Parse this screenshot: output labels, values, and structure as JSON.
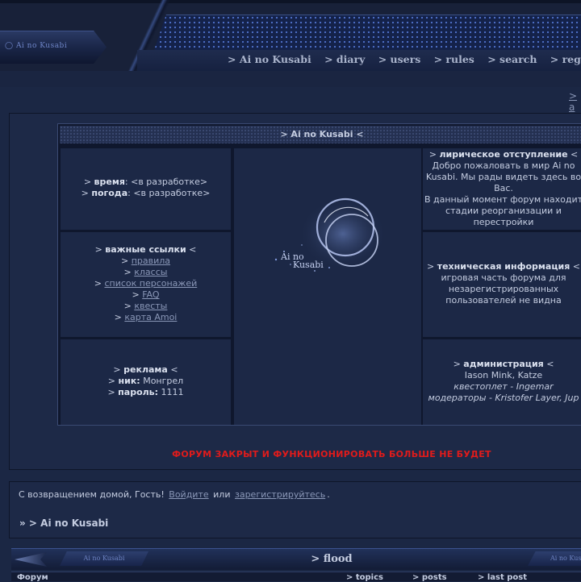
{
  "header": {
    "logo_small": "Ai no Kusabi",
    "nav": [
      "> Ai no Kusabi",
      "> diary",
      "> users",
      "> rules",
      "> search",
      "> registration",
      ">"
    ]
  },
  "corner_link": "> a",
  "table": {
    "title": "> Ai no Kusabi <",
    "left1": {
      "line1_prefix": ">",
      "line1_key": "время",
      "line1_val": ": <в разработке>",
      "line2_prefix": ">",
      "line2_key": "погода",
      "line2_val": ": <в разработке>"
    },
    "left2": {
      "title": "важные ссылки",
      "links": [
        "правила",
        "классы",
        "список персонажей",
        "FAQ",
        "квесты",
        "карта Amoi"
      ]
    },
    "left3": {
      "title": "реклама",
      "nick_key": "ник:",
      "nick_val": "Монгрел",
      "pass_key": "пароль:",
      "pass_val": "1111"
    },
    "logo_text_1": "Ai no",
    "logo_text_2": "Kusabi",
    "right1": {
      "title": "лирическое отступление",
      "text1": "Добро пожаловать в мир Ai no",
      "text2": "Kusabi. Мы рады видеть здесь во",
      "text3": "Вас.",
      "text4": "В данный момент форум находит",
      "text5": "стадии реорганизации и",
      "text6": "перестройки"
    },
    "right2": {
      "title": "техническая информация",
      "text1": "игровая часть форума для",
      "text2": "незарегистрированных",
      "text3": "пользователей не видна"
    },
    "right3": {
      "title": "администрация",
      "admins": "Iason Mink, Katze",
      "quest": "квестоплет - Ingemar",
      "mods": "модераторы - Kristofer Layer, Jup"
    },
    "closed_notice": "ФОРУМ ЗАКРЫТ И ФУНКЦИОНИРОВАТЬ БОЛЬШЕ НЕ БУДЕТ"
  },
  "welcome": {
    "greeting": "С возвращением домой, Гость!",
    "login": "Войдите",
    "or": "или",
    "register": "зарегистрируйтесь",
    "dot": "."
  },
  "breadcrumb": "» > Ai no Kusabi",
  "category": {
    "title": "> flood",
    "tab_logo": "Ai no Kusabi",
    "columns": [
      "Форум",
      "> topics",
      "> posts",
      "> last post"
    ]
  },
  "colors": {
    "background": "#1b2744",
    "panel": "#1d2947",
    "cell": "#1c2846",
    "alert": "#e01b1b"
  }
}
